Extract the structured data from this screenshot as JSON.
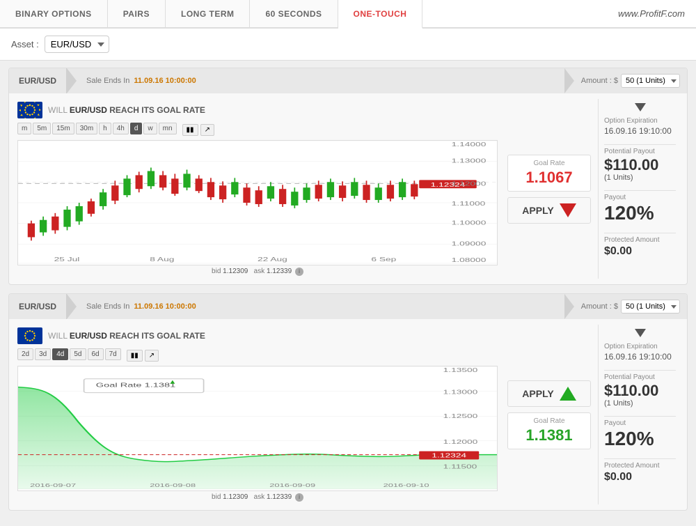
{
  "tabs": [
    {
      "id": "binary-options",
      "label": "BINARY OPTIONS",
      "active": false
    },
    {
      "id": "pairs",
      "label": "PAIRS",
      "active": false
    },
    {
      "id": "long-term",
      "label": "LONG TERM",
      "active": false
    },
    {
      "id": "60-seconds",
      "label": "60 SECONDS",
      "active": false
    },
    {
      "id": "one-touch",
      "label": "ONE-TOUCH",
      "active": true
    }
  ],
  "watermark": "www.ProfitF.com",
  "asset": {
    "label": "Asset :",
    "value": "EUR/USD"
  },
  "card1": {
    "header": {
      "asset": "EUR/USD",
      "sale_label": "Sale Ends In",
      "sale_time": "11.09.16 10:00:00",
      "amount_label": "Amount : $",
      "amount_value": "50 (1 Units)"
    },
    "chart": {
      "title_will": "WILL",
      "title_pair": "EUR/USD",
      "title_rest": "REACH ITS GOAL RATE",
      "time_buttons": [
        "m",
        "5m",
        "15m",
        "30m",
        "h",
        "4h",
        "d",
        "w",
        "mn"
      ],
      "active_time": "d",
      "y_labels": [
        "1.14000",
        "1.13000",
        "1.12000",
        "1.11000",
        "1.10000",
        "1.09000",
        "1.08000"
      ],
      "x_labels": [
        "25 Jul",
        "8 Aug",
        "22 Aug",
        "6 Sep"
      ],
      "current_price": "1.12324",
      "bid": "1.12309",
      "ask": "1.12339"
    },
    "goal_rate": {
      "label": "Goal Rate",
      "value": "1.1067",
      "direction": "down"
    },
    "apply_label": "APPLY",
    "side": {
      "expiry_label": "Option Expiration",
      "expiry_value": "16.09.16 19:10:00",
      "payout_label": "Potential Payout",
      "payout_value": "$110.00",
      "payout_sub": "(1 Units)",
      "pct_label": "Payout",
      "pct_value": "120%",
      "protected_label": "Protected Amount",
      "protected_value": "$0.00"
    }
  },
  "card2": {
    "header": {
      "asset": "EUR/USD",
      "sale_label": "Sale Ends In",
      "sale_time": "11.09.16 10:00:00",
      "amount_label": "Amount : $",
      "amount_value": "50 (1 Units)"
    },
    "chart": {
      "title_will": "WILL",
      "title_pair": "EUR/USD",
      "title_rest": "REACH ITS GOAL RATE",
      "time_buttons": [
        "2d",
        "3d",
        "4d",
        "5d",
        "6d",
        "7d"
      ],
      "active_time": "4d",
      "tooltip_label": "Goal Rate",
      "tooltip_value": "1.1381",
      "y_labels": [
        "1.13500",
        "1.13000",
        "1.12500",
        "1.12000",
        "1.11500"
      ],
      "x_labels": [
        "2016-09-07",
        "2016-09-08",
        "2016-09-09",
        "2016-09-10"
      ],
      "current_price": "1.12324",
      "bid": "1.12309",
      "ask": "1.12339"
    },
    "goal_rate": {
      "label": "Goal Rate",
      "value": "1.1381",
      "direction": "up"
    },
    "apply_label": "APPLY",
    "side": {
      "expiry_label": "Option Expiration",
      "expiry_value": "16.09.16 19:10:00",
      "payout_label": "Potential Payout",
      "payout_value": "$110.00",
      "payout_sub": "(1 Units)",
      "pct_label": "Payout",
      "pct_value": "120%",
      "protected_label": "Protected Amount",
      "protected_value": "$0.00"
    }
  }
}
